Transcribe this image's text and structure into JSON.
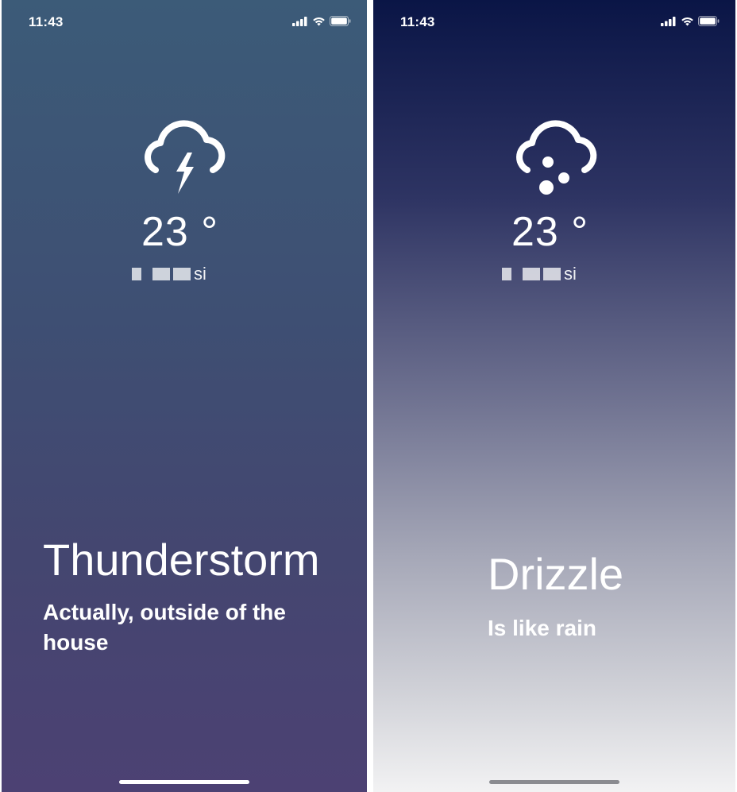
{
  "screens": [
    {
      "status_time": "11:43",
      "icon": "thunderstorm-icon",
      "temperature": "23 °",
      "location_suffix": "si",
      "condition": "Thunderstorm",
      "description": "Actually, outside of the house"
    },
    {
      "status_time": "11:43",
      "icon": "drizzle-icon",
      "temperature": "23 °",
      "location_suffix": "si",
      "condition": "Drizzle",
      "description": "Is like rain"
    }
  ],
  "colors": {
    "text": "#ffffff",
    "left_top": "#3c5b78",
    "left_bottom": "#4c4173",
    "right_top": "#0a1546",
    "right_bottom": "#f2f2f3"
  }
}
